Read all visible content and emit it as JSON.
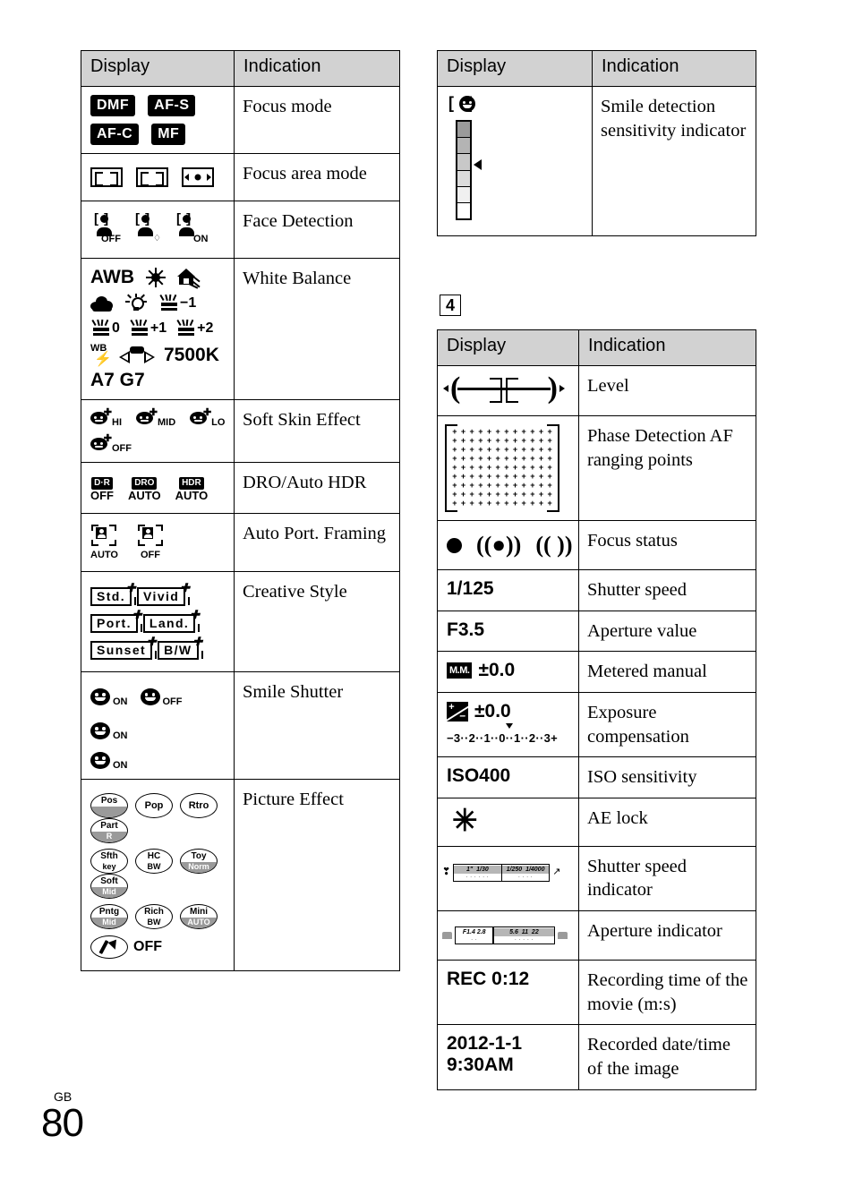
{
  "page": {
    "language_code": "GB",
    "page_number": "80",
    "section_marker": "4"
  },
  "tables": {
    "left": {
      "headers": {
        "display": "Display",
        "indication": "Indication"
      },
      "rows": [
        {
          "indication": "Focus mode",
          "display_items": [
            "DMF",
            "AF-S",
            "AF-C",
            "MF"
          ]
        },
        {
          "indication": "Focus area mode",
          "display_items": [
            "multi-point-af-icon",
            "center-af-icon",
            "flexible-spot-af-icon"
          ]
        },
        {
          "indication": "Face Detection",
          "display_items": [
            "OFF",
            "registration",
            "ON"
          ]
        },
        {
          "indication": "White Balance",
          "display_items": [
            "AWB",
            "daylight",
            "shade",
            "cloudy",
            "incandescent",
            "-1",
            "0",
            "+1",
            "+2",
            "WB-flash",
            "custom",
            "7500K",
            "A7 G7"
          ],
          "labels": {
            "awb": "AWB",
            "fluo_minus1": "−1",
            "fluo_0": "0",
            "fluo_plus1": "+1",
            "fluo_plus2": "+2",
            "wb": "WB",
            "kelvin": "7500K",
            "ab_gm": "A7 G7"
          }
        },
        {
          "indication": "Soft Skin Effect",
          "display_items": [
            "HI",
            "MID",
            "LO",
            "OFF"
          ]
        },
        {
          "indication": "DRO/Auto HDR",
          "display_items": [
            {
              "chip": "D·R",
              "under": "OFF"
            },
            {
              "chip": "DRO",
              "under": "AUTO"
            },
            {
              "chip": "HDR",
              "under": "AUTO"
            }
          ]
        },
        {
          "indication": "Auto Port. Framing",
          "display_items": [
            "AUTO",
            "OFF"
          ]
        },
        {
          "indication": "Creative Style",
          "display_items": [
            "Std.",
            "Vivid",
            "Port.",
            "Land.",
            "Sunset",
            "B/W"
          ]
        },
        {
          "indication": "Smile Shutter",
          "display_items": [
            "ON",
            "OFF",
            "ON",
            "ON"
          ]
        },
        {
          "indication": "Picture Effect",
          "display_items": [
            {
              "top": "Pos",
              "bottom": "",
              "shaded": true
            },
            {
              "top": "Pop",
              "bottom": "",
              "shaded": false
            },
            {
              "top": "Rtro",
              "bottom": "",
              "shaded": false
            },
            {
              "top": "Part",
              "bottom": "R",
              "shaded": true
            },
            {
              "top": "Sfth",
              "bottom": "key",
              "shaded": false
            },
            {
              "top": "HC",
              "bottom": "BW",
              "shaded": false
            },
            {
              "top": "Toy",
              "bottom": "Norm",
              "shaded": true
            },
            {
              "top": "Soft",
              "bottom": "Mid",
              "shaded": true
            },
            {
              "top": "Pntg",
              "bottom": "Mid",
              "shaded": true
            },
            {
              "top": "Rich",
              "bottom": "BW",
              "shaded": false
            },
            {
              "top": "Mini",
              "bottom": "AUTO",
              "shaded": true
            }
          ],
          "off_label": "OFF"
        }
      ]
    },
    "right_top": {
      "headers": {
        "display": "Display",
        "indication": "Indication"
      },
      "rows": [
        {
          "indication": "Smile detection sensitivity indicator",
          "display_items": [
            "smile-sensitivity-bar"
          ]
        }
      ]
    },
    "right_bottom": {
      "headers": {
        "display": "Display",
        "indication": "Indication"
      },
      "rows": [
        {
          "indication": "Level",
          "display_text": ""
        },
        {
          "indication": "Phase Detection AF ranging points",
          "display_text": ""
        },
        {
          "indication": "Focus status",
          "display_text": ""
        },
        {
          "indication": "Shutter speed",
          "display_text": "1/125"
        },
        {
          "indication": "Aperture value",
          "display_text": "F3.5"
        },
        {
          "indication": "Metered manual",
          "display_text": "±0.0",
          "chip": "M.M."
        },
        {
          "indication": "Exposure compensation",
          "display_text": "±0.0",
          "scale": "−3··2··1··0··1··2··3+"
        },
        {
          "indication": "ISO sensitivity",
          "display_text": "ISO400"
        },
        {
          "indication": "AE lock",
          "display_text": "✳"
        },
        {
          "indication": "Shutter speed indicator",
          "scale_labels": [
            "1\"",
            "1/30",
            "1/250",
            "1/4000"
          ]
        },
        {
          "indication": "Aperture indicator",
          "scale_labels": [
            "F1.4",
            "2.8",
            "5.6",
            "11",
            "22"
          ]
        },
        {
          "indication": "Recording time of the movie (m:s)",
          "display_text": "REC 0:12"
        },
        {
          "indication": "Recorded date/time of the image",
          "display_text": "2012-1-1 9:30AM",
          "line1": "2012-1-1",
          "line2": "9:30AM"
        }
      ]
    }
  },
  "colors": {
    "header_bg": "#d2d2d2",
    "border": "#000000",
    "shade_gray": "#9a9a9a",
    "scale_gray": "#b6b6b6",
    "page_bg": "#ffffff"
  }
}
